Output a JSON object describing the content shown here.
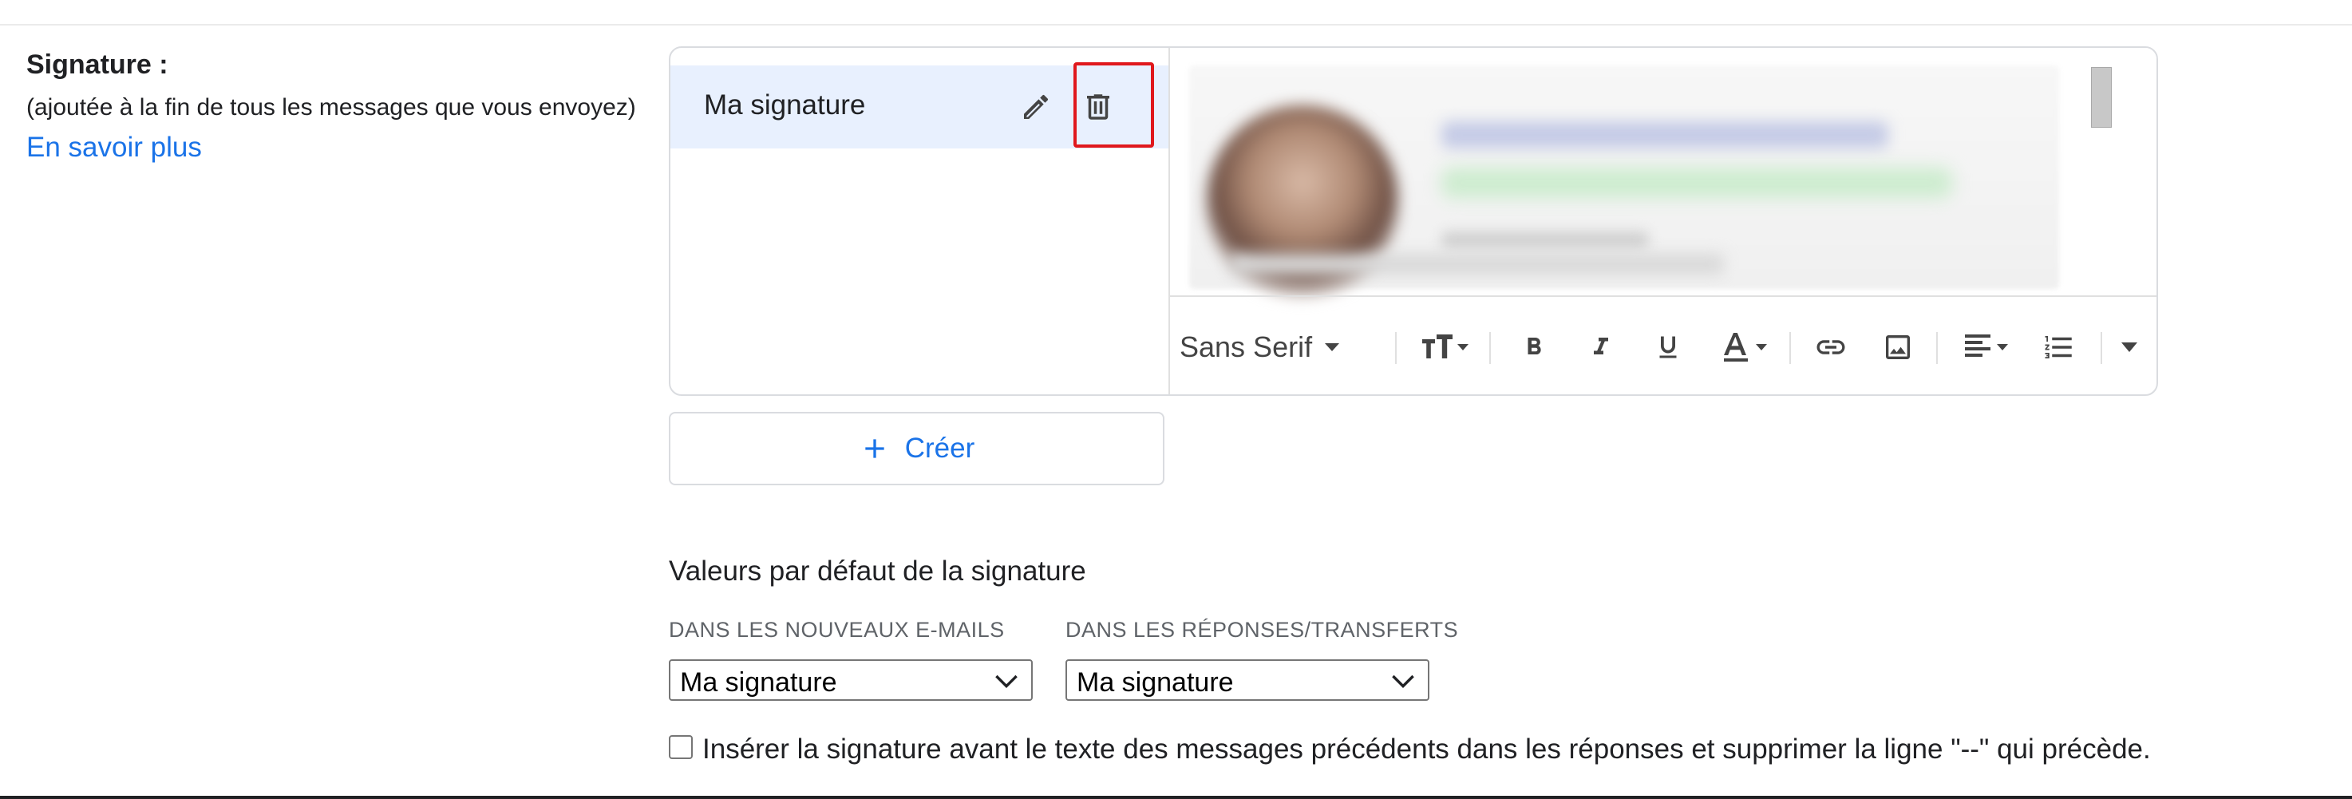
{
  "signature": {
    "title": "Signature :",
    "subtitle": "(ajoutée à la fin de tous les messages que vous envoyez)",
    "learn_more": "En savoir plus",
    "items": [
      {
        "label": "Ma signature"
      }
    ],
    "create_label": "Créer"
  },
  "toolbar": {
    "font": "Sans Serif",
    "tools": [
      "font-size-icon",
      "bold-icon",
      "italic-icon",
      "underline-icon",
      "text-color-icon",
      "link-icon",
      "image-icon",
      "align-icon",
      "numbered-list-icon",
      "more-options-icon"
    ]
  },
  "defaults": {
    "title": "Valeurs par défaut de la signature",
    "new_emails_label": "DANS LES NOUVEAUX E-MAILS",
    "new_emails_value": "Ma signature",
    "replies_label": "DANS LES RÉPONSES/TRANSFERTS",
    "replies_value": "Ma signature",
    "insert_before_label": "Insérer la signature avant le texte des messages précédents dans les réponses et supprimer la ligne \"--\" qui précède.",
    "insert_before_checked": false
  },
  "colors": {
    "accent": "#1a73e8",
    "selected_row": "#e8f0fe",
    "highlight": "#e0181c"
  }
}
